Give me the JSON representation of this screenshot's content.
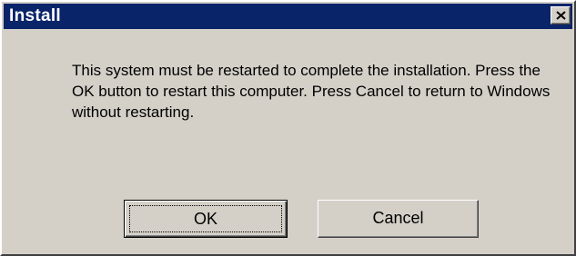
{
  "window": {
    "title": "Install",
    "close_icon": "close-icon",
    "colors": {
      "titlebar": "#0a246a",
      "face": "#d4d0c8",
      "title_text": "#ffffff"
    }
  },
  "message": "This system must be restarted to complete the installation. Press the OK button to restart this computer. Press Cancel to return to Windows without restarting.",
  "buttons": {
    "ok": "OK",
    "cancel": "Cancel"
  }
}
